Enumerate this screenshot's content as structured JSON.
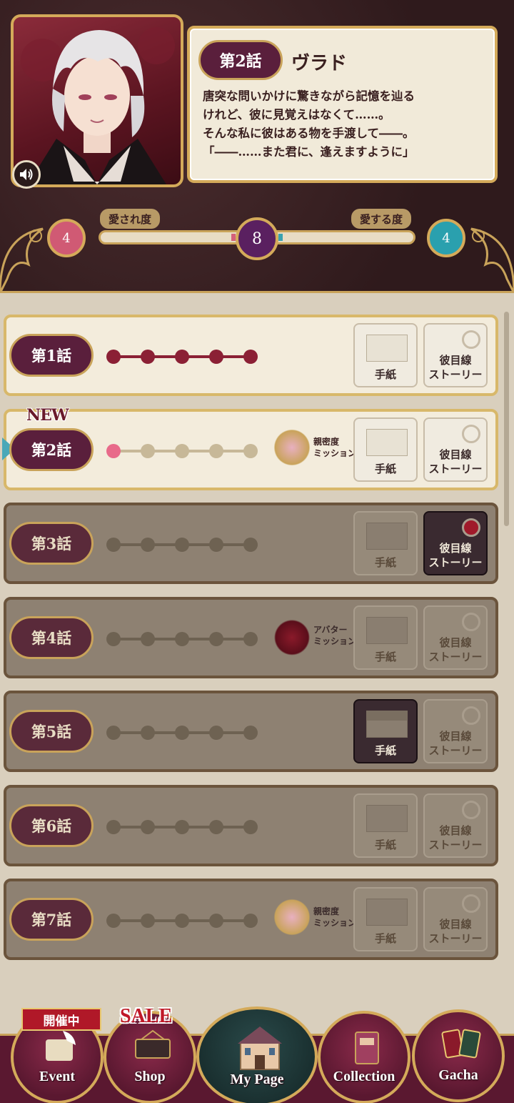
{
  "header": {
    "episode_badge": "第2話",
    "character_name": "ヴラド",
    "description_lines": [
      "唐突な問いかけに驚きながら記憶を辿る",
      "けれど、彼に見覚えはなくて……。",
      "そんな私に彼はある物を手渡して――。",
      "「――……また君に、逢えますように」"
    ],
    "meter": {
      "left_label": "愛され度",
      "right_label": "愛する度",
      "left_value": "4",
      "center_value": "8",
      "right_value": "4"
    }
  },
  "episodes": [
    {
      "label": "第1話",
      "state": "unlocked",
      "progress": 5,
      "mission": "",
      "new": false,
      "letter_label": "手紙",
      "story_label_1": "彼目線",
      "story_label_2": "ストーリー"
    },
    {
      "label": "第2話",
      "state": "current",
      "progress": 1,
      "mission": "親密度\nミッション",
      "new": true,
      "new_label": "NEW",
      "letter_label": "手紙",
      "story_label_1": "彼目線",
      "story_label_2": "ストーリー"
    },
    {
      "label": "第3話",
      "state": "locked",
      "progress": 0,
      "mission": "",
      "new": false,
      "letter_label": "手紙",
      "story_label_1": "彼目線",
      "story_label_2": "ストーリー",
      "story_active": true
    },
    {
      "label": "第4話",
      "state": "locked",
      "progress": 0,
      "mission": "アバター\nミッション",
      "new": false,
      "letter_label": "手紙",
      "story_label_1": "彼目線",
      "story_label_2": "ストーリー"
    },
    {
      "label": "第5話",
      "state": "locked",
      "progress": 0,
      "mission": "",
      "new": false,
      "letter_label": "手紙",
      "story_label_1": "彼目線",
      "story_label_2": "ストーリー",
      "letter_active": true
    },
    {
      "label": "第6話",
      "state": "locked",
      "progress": 0,
      "mission": "",
      "new": false,
      "letter_label": "手紙",
      "story_label_1": "彼目線",
      "story_label_2": "ストーリー"
    },
    {
      "label": "第7話",
      "state": "locked",
      "progress": 0,
      "mission": "親密度\nミッション",
      "new": false,
      "letter_label": "手紙",
      "story_label_1": "彼目線",
      "story_label_2": "ストーリー"
    }
  ],
  "nav": {
    "event_badge": "開催中",
    "sale_badge": "SALE",
    "event": "Event",
    "shop": "Shop",
    "mypage": "My Page",
    "collection": "Collection",
    "gacha": "Gacha"
  },
  "colors": {
    "header_bg": "#3a2224",
    "gold": "#d4aa5a",
    "wine": "#5a1f3c",
    "pink": "#d05a74",
    "teal": "#2aa0ae",
    "locked_bg": "#8e8172"
  }
}
